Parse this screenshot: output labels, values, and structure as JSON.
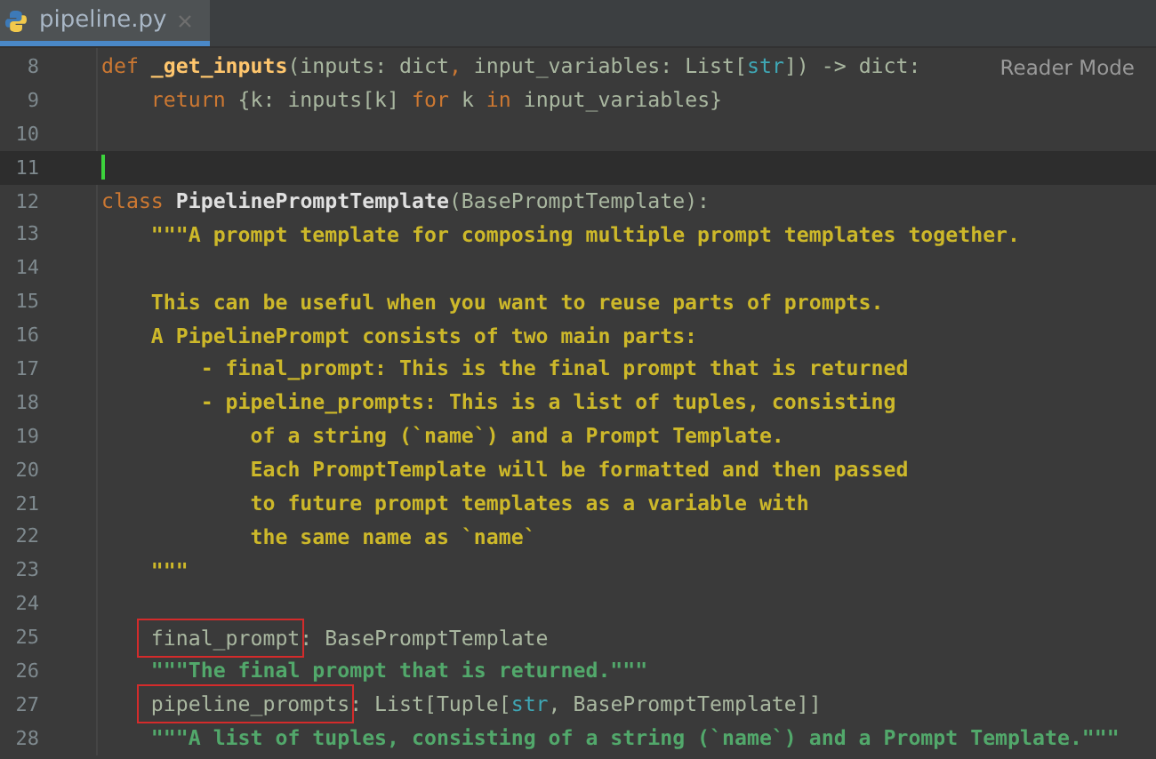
{
  "tabs": [
    {
      "label": "pipeline.py",
      "selected": true
    }
  ],
  "reader_mode": "Reader Mode",
  "lines": [
    {
      "number": "8",
      "current": false,
      "tokens": [
        {
          "kind": "keyword",
          "text": "def "
        },
        {
          "kind": "function",
          "text": "_get_inputs"
        },
        {
          "kind": "plain",
          "text": "(inputs: dict"
        },
        {
          "kind": "keyword",
          "text": ", "
        },
        {
          "kind": "plain",
          "text": "input_variables: List["
        },
        {
          "kind": "builtin",
          "text": "str"
        },
        {
          "kind": "plain",
          "text": "]) -> dict:"
        }
      ]
    },
    {
      "number": "9",
      "current": false,
      "tokens": [
        {
          "kind": "keyword",
          "text": "    return "
        },
        {
          "kind": "plain",
          "text": "{k: inputs[k] "
        },
        {
          "kind": "keyword",
          "text": "for "
        },
        {
          "kind": "plain",
          "text": "k "
        },
        {
          "kind": "keyword",
          "text": "in "
        },
        {
          "kind": "plain",
          "text": "input_variables}"
        }
      ]
    },
    {
      "number": "10",
      "current": false
    },
    {
      "number": "11",
      "current": true
    },
    {
      "number": "12",
      "current": false,
      "tokens": [
        {
          "kind": "keyword",
          "text": "class "
        },
        {
          "kind": "classname",
          "text": "PipelinePromptTemplate"
        },
        {
          "kind": "plain",
          "text": "(BasePromptTemplate):"
        }
      ]
    },
    {
      "number": "13",
      "current": false,
      "tokens": [
        {
          "kind": "docstring",
          "text": "    \"\"\"A prompt template for composing multiple prompt templates together."
        }
      ]
    },
    {
      "number": "14",
      "current": false
    },
    {
      "number": "15",
      "current": false,
      "tokens": [
        {
          "kind": "docstring",
          "text": "    This can be useful when you want to reuse parts of prompts."
        }
      ]
    },
    {
      "number": "16",
      "current": false,
      "tokens": [
        {
          "kind": "docstring",
          "text": "    A PipelinePrompt consists of two main parts:"
        }
      ]
    },
    {
      "number": "17",
      "current": false,
      "tokens": [
        {
          "kind": "docstring",
          "text": "        - final_prompt: This is the final prompt that is returned"
        }
      ]
    },
    {
      "number": "18",
      "current": false,
      "tokens": [
        {
          "kind": "docstring",
          "text": "        - pipeline_prompts: This is a list of tuples, consisting"
        }
      ]
    },
    {
      "number": "19",
      "current": false,
      "tokens": [
        {
          "kind": "docstring",
          "text": "            of a string (`name`) and a Prompt Template."
        }
      ]
    },
    {
      "number": "20",
      "current": false,
      "tokens": [
        {
          "kind": "docstring",
          "text": "            Each PromptTemplate will be formatted and then passed"
        }
      ]
    },
    {
      "number": "21",
      "current": false,
      "tokens": [
        {
          "kind": "docstring",
          "text": "            to future prompt templates as a variable with"
        }
      ]
    },
    {
      "number": "22",
      "current": false,
      "tokens": [
        {
          "kind": "docstring",
          "text": "            the same name as `name`"
        }
      ]
    },
    {
      "number": "23",
      "current": false,
      "tokens": [
        {
          "kind": "docstring",
          "text": "    \"\"\""
        }
      ]
    },
    {
      "number": "24",
      "current": false
    },
    {
      "number": "25",
      "current": false,
      "indented": true,
      "tokens": [
        {
          "kind": "boxed",
          "text": "final_prompt"
        },
        {
          "kind": "plain",
          "text": ": BasePromptTemplate"
        }
      ]
    },
    {
      "number": "26",
      "current": false,
      "tokens": [
        {
          "kind": "attrdoc",
          "text": "    \"\"\"The final prompt that is returned.\"\"\""
        }
      ]
    },
    {
      "number": "27",
      "current": false,
      "indented": true,
      "tokens": [
        {
          "kind": "boxed",
          "text": "pipeline_prompts"
        },
        {
          "kind": "plain",
          "text": ": List[Tuple["
        },
        {
          "kind": "builtin",
          "text": "str"
        },
        {
          "kind": "plain",
          "text": ", BasePromptTemplate]]"
        }
      ]
    },
    {
      "number": "28",
      "current": false,
      "tokens": [
        {
          "kind": "attrdoc",
          "text": "    \"\"\"A list of tuples, consisting of a string (`name`) and a Prompt Template.\"\"\""
        }
      ]
    }
  ]
}
